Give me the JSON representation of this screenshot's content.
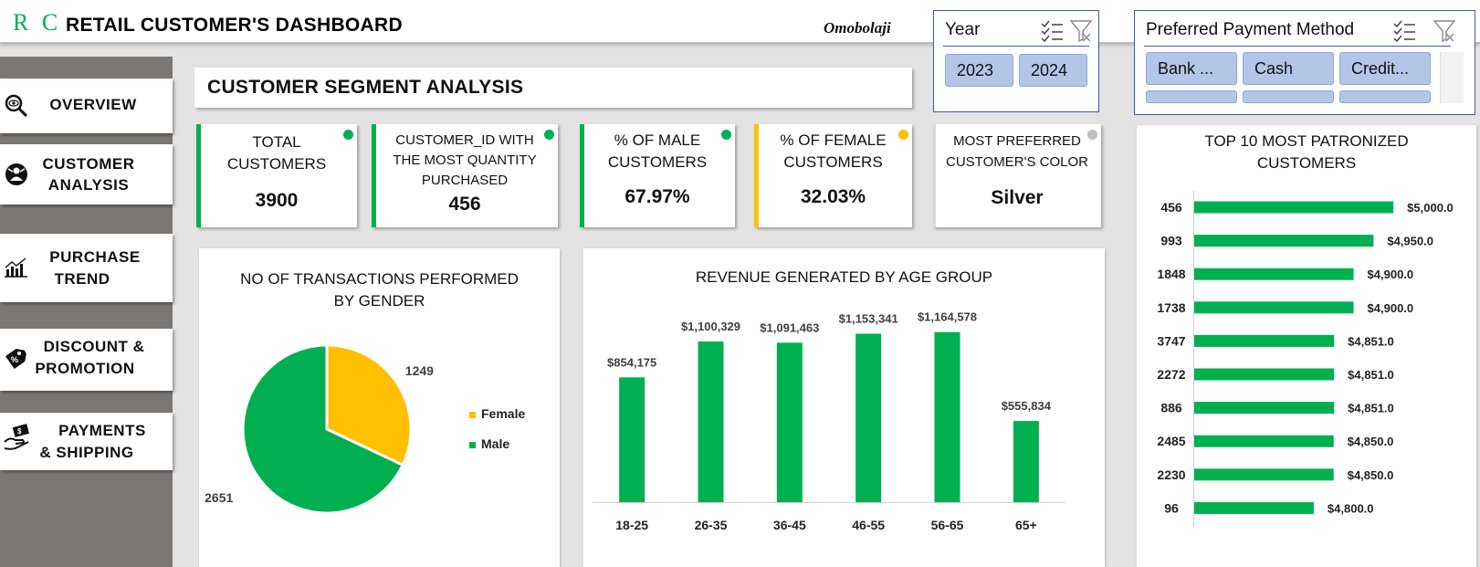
{
  "header": {
    "logo": "R C",
    "title": "RETAIL CUSTOMER'S DASHBOARD",
    "author": "Omobolaji"
  },
  "slicers": {
    "year": {
      "title": "Year",
      "options": [
        "2023",
        "2024"
      ]
    },
    "payment": {
      "title": "Preferred Payment Method",
      "options": [
        "Bank ...",
        "Cash",
        "Credit..."
      ]
    }
  },
  "sidebar": {
    "items": [
      {
        "label": "OVERVIEW",
        "icon": "search-eye-icon"
      },
      {
        "label": "CUSTOMER",
        "label2": "ANALYSIS",
        "icon": "user-icon"
      },
      {
        "label": "PURCHASE",
        "label2": "TREND",
        "icon": "bar-chart-icon"
      },
      {
        "label": "DISCOUNT &",
        "label2": "PROMOTION",
        "icon": "discount-tag-icon"
      },
      {
        "label": "PAYMENTS",
        "label2": "& SHIPPING",
        "icon": "payment-hand-icon"
      }
    ]
  },
  "section_title": "CUSTOMER SEGMENT ANALYSIS",
  "kpis": [
    {
      "label": "TOTAL",
      "label2": "CUSTOMERS",
      "value": "3900",
      "status_color": "#00b050"
    },
    {
      "label": "CUSTOMER_ID WITH",
      "label2": "THE MOST QUANTITY",
      "label3": "PURCHASED",
      "value": "456",
      "status_color": "#00b050"
    },
    {
      "label": "% OF MALE",
      "label2": "CUSTOMERS",
      "value": "67.97%",
      "status_color": "#00b050"
    },
    {
      "label": "% OF FEMALE",
      "label2": "CUSTOMERS",
      "value": "32.03%",
      "status_color": "#ffc000"
    },
    {
      "label": "MOST PREFERRED",
      "label2": "CUSTOMER'S COLOR",
      "value": "Silver",
      "status_color": "#bfbfbf"
    }
  ],
  "colors": {
    "green": "#00b050",
    "yellow": "#ffc000",
    "gray": "#bfbfbf",
    "slicer_chip": "#b4c6e7",
    "slicer_border": "#3b5cab"
  },
  "chart_data": [
    {
      "type": "pie",
      "title": "NO OF TRANSACTIONS PERFORMED BY GENDER",
      "title_line1": "NO OF TRANSACTIONS PERFORMED",
      "title_line2": "BY GENDER",
      "categories": [
        "Female",
        "Male"
      ],
      "values": [
        1249,
        2651
      ],
      "colors": [
        "#ffc000",
        "#00b050"
      ],
      "legend": "right"
    },
    {
      "type": "bar",
      "title": "REVENUE GENERATED BY AGE GROUP",
      "categories": [
        "18-25",
        "26-35",
        "36-45",
        "46-55",
        "56-65",
        "65+"
      ],
      "values": [
        854175,
        1100329,
        1091463,
        1153341,
        1164578,
        555834
      ],
      "labels": [
        "$854,175",
        "$1,100,329",
        "$1,091,463",
        "$1,153,341",
        "$1,164,578",
        "$555,834"
      ],
      "color": "#00b050",
      "ylim": [
        0,
        1250000
      ],
      "grid": false
    },
    {
      "type": "bar",
      "orientation": "horizontal",
      "title": "TOP 10 MOST PATRONIZED CUSTOMERS",
      "title_line1": "TOP 10 MOST PATRONIZED",
      "title_line2": "CUSTOMERS",
      "categories": [
        "456",
        "993",
        "1848",
        "1738",
        "3747",
        "2272",
        "886",
        "2485",
        "2230",
        "96"
      ],
      "values": [
        5000.0,
        4950.0,
        4900.0,
        4900.0,
        4851.0,
        4851.0,
        4851.0,
        4850.0,
        4850.0,
        4800.0
      ],
      "labels": [
        "$5,000.0",
        "$4,950.0",
        "$4,900.0",
        "$4,900.0",
        "$4,851.0",
        "$4,851.0",
        "$4,851.0",
        "$4,850.0",
        "$4,850.0",
        "$4,800.0"
      ],
      "color": "#00b050",
      "xlim": [
        4500,
        5050
      ],
      "grid": false
    }
  ]
}
